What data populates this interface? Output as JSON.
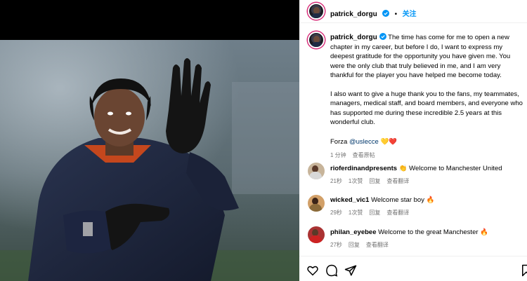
{
  "post": {
    "username": "patrick_dorgu",
    "follow_label": "关注",
    "caption_p1": "The time has come for me to open a new chapter in my career, but before I do, I want to express my deepest gratitude for the opportunity you have given me. You were the only club that truly believed in me, and I am very thankful for the player you have helped me become today.",
    "caption_p2": "I also want to give a huge thank you to the fans, my teammates, managers, medical staff, and board members, and everyone who has supported me during these incredible 2.5 years at this wonderful club.",
    "caption_p3_prefix": "Forza ",
    "caption_p3_mention": "@uslecce",
    "caption_p3_emoji": "💛❤️",
    "time": "1 分钟",
    "see_translation": "查看原帖"
  },
  "comments": [
    {
      "username": "rioferdinandpresents",
      "emoji": "👏",
      "text": "Welcome to Manchester United",
      "time": "21秒",
      "likes": "1次赞",
      "reply": "回复",
      "translate": "查看翻译"
    },
    {
      "username": "wicked_vic1",
      "emoji": "",
      "text": "Welcome star boy",
      "trail_emoji": "🔥",
      "time": "29秒",
      "likes": "1次赞",
      "reply": "回复",
      "translate": "查看翻译"
    },
    {
      "username": "philan_eyebee",
      "emoji": "",
      "text": "Welcome to the great Manchester",
      "trail_emoji": "🔥",
      "time": "27秒",
      "likes": "",
      "reply": "回复",
      "translate": "查看翻译"
    }
  ],
  "icons": {
    "like": "heart-icon",
    "comment": "comment-icon",
    "share": "share-icon",
    "save": "bookmark-icon",
    "verified": "verified-badge-icon"
  },
  "colors": {
    "follow": "#0095f6",
    "verified": "#0095f6",
    "meta": "#737373"
  }
}
